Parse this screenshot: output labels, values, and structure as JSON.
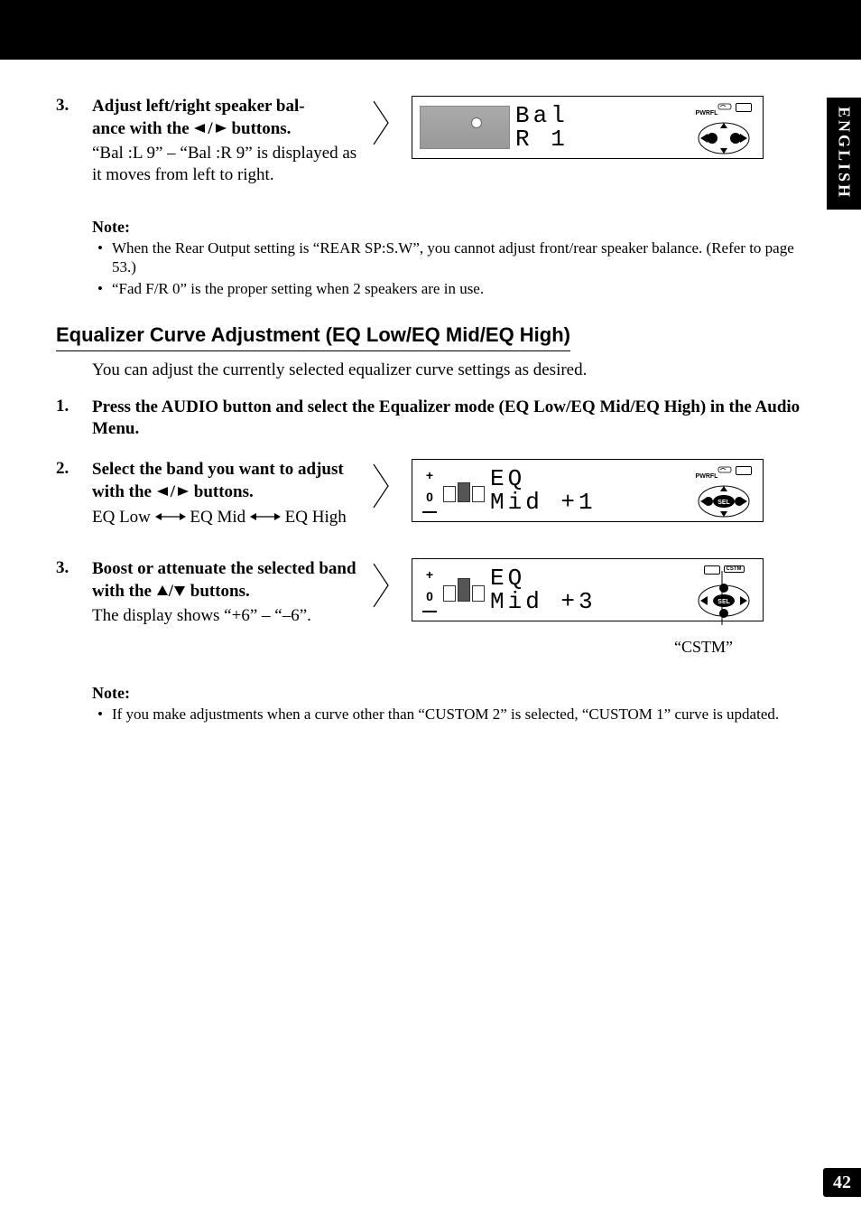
{
  "sideTab": "ENGLISH",
  "pageNumber": "42",
  "balanceStep": {
    "num": "3.",
    "title_a": "Adjust left/right speaker bal-",
    "title_b": "ance with the ",
    "title_c": " buttons.",
    "body": "“Bal :L 9” – “Bal :R 9” is displayed as it moves from left to right.",
    "display_line1": "Bal",
    "display_line2": "R   1"
  },
  "note1": {
    "title": "Note:",
    "items": [
      "When the Rear Output setting is “REAR SP:S.W”, you cannot adjust front/rear speaker balance. (Refer to page 53.)",
      "“Fad F/R 0” is the proper setting when 2 speakers are in use."
    ]
  },
  "sectionHeading": "Equalizer Curve Adjustment (EQ Low/EQ Mid/EQ High)",
  "sectionIntro": "You can adjust the currently selected equalizer curve settings as desired.",
  "eqStep1": {
    "num": "1.",
    "title": "Press the AUDIO button and select the Equalizer mode (EQ Low/EQ Mid/EQ High) in the Audio Menu."
  },
  "eqStep2": {
    "num": "2.",
    "title_a": "Select the band you want to adjust with the ",
    "title_b": " buttons.",
    "seq_a": "EQ Low ",
    "seq_b": " EQ Mid ",
    "seq_c": " EQ High",
    "display_line1": "EQ",
    "display_line2": "Mid +1"
  },
  "eqStep3": {
    "num": "3.",
    "title_a": "Boost or attenuate the selected band with the ",
    "title_b": " buttons.",
    "body": "The display shows “+6” – “–6”.",
    "display_line1": "EQ",
    "display_line2": "Mid +3"
  },
  "cstmLabel": "“CSTM”",
  "note2": {
    "title": "Note:",
    "items": [
      "If you make adjustments when a curve other than “CUSTOM 2” is selected, “CUSTOM 1” curve is updated."
    ]
  },
  "icons": {
    "left": "2",
    "right": "3",
    "up": "5",
    "down": "∇",
    "plus": "+",
    "zero": "0",
    "minus": "–",
    "pwrfl": "PWRFL",
    "sel": "SEL",
    "cstm_small": "CSTM"
  }
}
